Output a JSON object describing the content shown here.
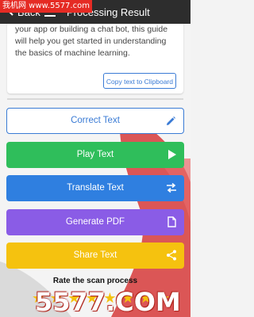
{
  "watermark_top": "我机网 www.5577.com",
  "watermark_bottom": "5577.COM",
  "appbar": {
    "back_label": "Back",
    "title": "Processing Result"
  },
  "scan_text": "your app or building a chat bot, this guide will help you get started in understanding the basics of machine learning.",
  "copy_button": "Copy text to Clipboard",
  "actions": {
    "correct": "Correct Text",
    "play": "Play Text",
    "translate": "Translate Text",
    "pdf": "Generate PDF",
    "share": "Share Text"
  },
  "rate_label": "Rate the scan process",
  "icons": {
    "correct": "pencil-icon",
    "play": "play-icon",
    "translate": "swap-arrows-icon",
    "pdf": "document-icon",
    "share": "share-icon"
  },
  "colors": {
    "appbar": "#2d2d2d",
    "accent_blue": "#3a7bd5",
    "play_green": "#2fbe5b",
    "translate_blue": "#2f7fe0",
    "pdf_purple": "#8a5ce6",
    "share_yellow": "#f5c20f"
  }
}
